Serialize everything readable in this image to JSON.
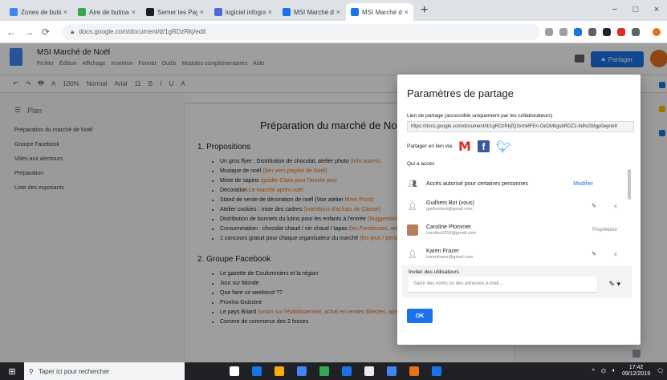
{
  "browser": {
    "tabs": [
      {
        "label": "Zones de butinage? D.",
        "color": "#4285f4"
      },
      {
        "label": "Aire de butinage",
        "color": "#34a853"
      },
      {
        "label": "Semer les Paysans",
        "color": "#1e1e1e"
      },
      {
        "label": "logiciel infographie",
        "color": "#4b6bd3"
      },
      {
        "label": "MSI Marché de Noël",
        "color": "#1a73e8"
      },
      {
        "label": "MSI Marché de Noël",
        "color": "#1a73e8"
      }
    ],
    "active_tab": 5,
    "new_tab": "+",
    "window_controls": [
      "−",
      "□",
      "×"
    ],
    "url": "docs.google.com/document/d/1gRDzRkj/edit"
  },
  "doc": {
    "title": "MSI Marché de Noël",
    "menus": [
      "Fichier",
      "Édition",
      "Affichage",
      "Insertion",
      "Format",
      "Outils",
      "Modules complémentaires",
      "Aide"
    ],
    "share_label": "Partager",
    "toolbar": [
      "↶",
      "↷",
      "🖶",
      "A",
      "100%",
      "Normal",
      "Arial",
      "11",
      "B",
      "I",
      "U",
      "A"
    ],
    "page_title": "Préparation du marché de Noël",
    "sections": [
      {
        "heading": "1. Propositions",
        "items": [
          {
            "text": "Un gros flyer : Distribution de chocolat, atelier photo ",
            "link": "(info autres)"
          },
          {
            "text": "Musique de noël ",
            "link": "(lien vers playlist de Noël)"
          },
          {
            "text": "Mixte de sapins ",
            "link": "(guider Clara pour l'année pro)"
          },
          {
            "text": "Décoration ",
            "link": "Le marché après noël"
          },
          {
            "text": "Stand de vente de décoration de noël (Voir atelier ",
            "link": "Mme Prost)"
          },
          {
            "text": "Atelier cookies : mise des cadres ",
            "link": "(Intentions d'achats de Classe)"
          },
          {
            "text": "Distribution de bonnets du lutins pour les enfants à l'entrée ",
            "link": "(Suggestion pour les bonnets de Noël)"
          },
          {
            "text": "Consommation : chocolat chaud / vin chaud / tapas ",
            "link": "(les Fondeuses, restauration)"
          },
          {
            "text": "1 concours gratuit pour chaque organisateur du marché ",
            "link": "(les jeux / personnes)"
          }
        ]
      },
      {
        "heading": "2. Groupe Facebook",
        "items": [
          {
            "text": "Le gazette de Coulommiers et la région",
            "link": ""
          },
          {
            "text": "Jour sur Monde",
            "link": ""
          },
          {
            "text": "Que faire ce weekend ??",
            "link": ""
          },
          {
            "text": "Provins Guissine",
            "link": ""
          },
          {
            "text": "Le pays Briard ",
            "link": "(union sur l'établissement, achat en ventes directes, après visite)"
          },
          {
            "text": "Comme de commerce des 2 fosses",
            "link": ""
          }
        ]
      }
    ],
    "outline": {
      "header": "Plan",
      "items": [
        "Préparation du marché de Noël",
        "Groupe Facebook",
        "Villes aux alentours",
        "Préparation",
        "Liste des exposants"
      ]
    }
  },
  "dialog": {
    "title": "Paramètres de partage",
    "link_label": "Lien de partage (accessible uniquement par les collaborateurs)",
    "link_value": "https://docs.google.com/document/d/1gRDzRkjfQ3xmMFEn-OeDMkgsbRDZ2-8dhs0Mgp0egrIe8",
    "share_via_label": "Partager en lien via",
    "who_label": "Qui a accès",
    "access_text": "Accès autorisé pour certaines personnes",
    "modify_label": "Modifier",
    "people": [
      {
        "name": "Guilhem Bot (vous)",
        "email": "guilhembot@gmail.com",
        "role": "✎",
        "icon": "person"
      },
      {
        "name": "Caroline Plommet",
        "email": "caroline2018@gmail.com",
        "role": "Propriétaire",
        "icon": "photo"
      },
      {
        "name": "Karen Frazer",
        "email": "karenfrazer@gmail.com",
        "role": "✎",
        "icon": "person"
      }
    ],
    "invite_label": "Inviter des utilisateurs",
    "invite_placeholder": "Saisir des noms ou des adresses e-mail...",
    "ok_label": "OK"
  },
  "taskbar": {
    "search_placeholder": "Taper ici pour rechercher",
    "time": "17:42",
    "date": "09/12/2019",
    "icons": [
      {
        "name": "task-view-icon",
        "color": "#ffffff"
      },
      {
        "name": "edge-icon",
        "color": "#1a73e8"
      },
      {
        "name": "explorer-icon",
        "color": "#f9ab00"
      },
      {
        "name": "store-icon",
        "color": "#4285f4"
      },
      {
        "name": "chrome-icon",
        "color": "#34a853"
      },
      {
        "name": "mail-icon",
        "color": "#1a73e8"
      },
      {
        "name": "app-icon",
        "color": "#e8eaed"
      },
      {
        "name": "photos-icon",
        "color": "#4285f4"
      },
      {
        "name": "firefox-icon",
        "color": "#e8711a"
      },
      {
        "name": "word-icon",
        "color": "#1a73e8"
      }
    ]
  }
}
